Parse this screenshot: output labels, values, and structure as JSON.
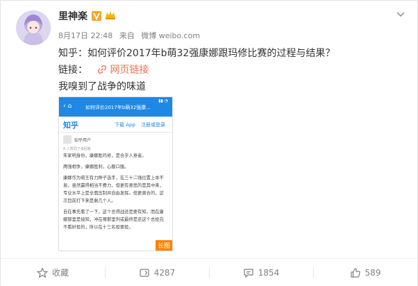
{
  "post": {
    "username": "里神楽",
    "date": "8月17日 22:48",
    "source_prefix": "来自",
    "source": "微博 weibo.com",
    "text_line1": "知乎：如何评价2017年b萌32强康娜跟玛修比赛的过程与结果？",
    "link_prefix": "链接：",
    "link_text": "网页链接",
    "text_line3": "我嗅到了战争的味道"
  },
  "screenshot": {
    "nav_title": "如何评价2017年b萌32强康...",
    "logo": "知乎",
    "download": "下载 App",
    "login": "注册或登录",
    "user": "知乎用户",
    "votes": "8 人赞同了该回答",
    "paragraphs": [
      "朱家明身份，康娜胜玛修，是合乎人意者。",
      "两强相争，康娜胜利，心服口服。",
      "康娜作为萌王有力种子选手，在三十二强位置上本不易，虽然赢得相当不费力，但更有意思的是其中来，专业水平上是全面压制并自由发挥。但更离合的，这次目前打下来是剩几个人。",
      "自在事先看了一下，这个总得战还是要有知，而在康娜那里是接知，冲在哪那里列或最终是还这个总投完不看好投的，所以在十三名投要投。"
    ],
    "long_image_label": "长图"
  },
  "actions": {
    "favorite": "收藏",
    "repost": "4287",
    "comment": "1854",
    "like": "589"
  }
}
